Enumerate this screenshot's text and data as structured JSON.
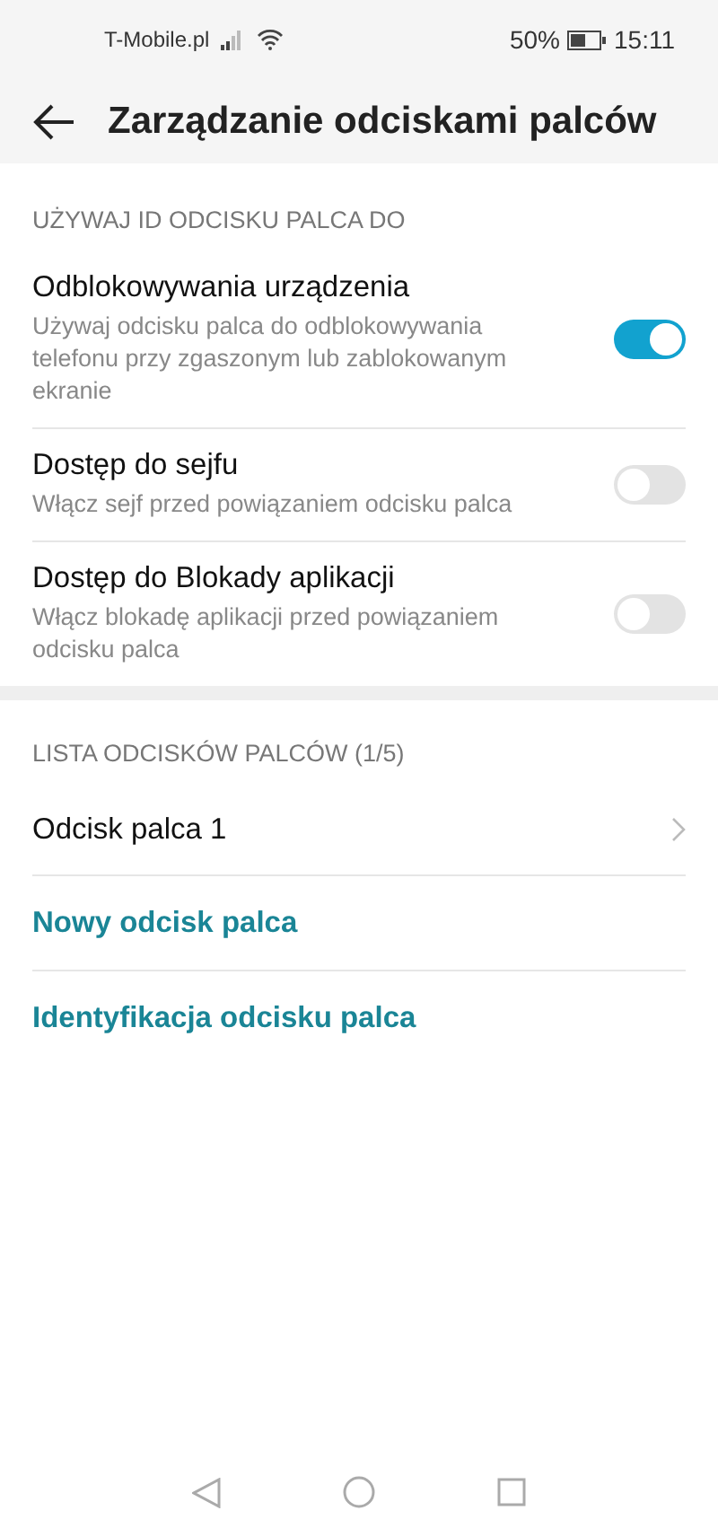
{
  "status_bar": {
    "carrier": "T-Mobile.pl",
    "battery": "50%",
    "time": "15:11"
  },
  "header": {
    "title": "Zarządzanie odciskami palców"
  },
  "sections": [
    {
      "title": "UŻYWAJ ID ODCISKU PALCA DO",
      "items": [
        {
          "kind": "toggle",
          "title": "Odblokowywania urządzenia",
          "subtitle": "Używaj odcisku palca do odblokowywania telefonu przy zgaszonym lub zablokowanym ekranie",
          "on": true
        },
        {
          "kind": "toggle",
          "title": "Dostęp do sejfu",
          "subtitle": "Włącz sejf przed powiązaniem odcisku palca",
          "on": false
        },
        {
          "kind": "toggle",
          "title": "Dostęp do Blokady aplikacji",
          "subtitle": "Włącz blokadę aplikacji przed powiązaniem odcisku palca",
          "on": false
        }
      ]
    },
    {
      "title": "LISTA ODCISKÓW PALCÓW (1/5)",
      "items": [
        {
          "kind": "nav",
          "title": "Odcisk palca 1"
        },
        {
          "kind": "action",
          "title": "Nowy odcisk palca"
        },
        {
          "kind": "action",
          "title": "Identyfikacja odcisku palca"
        }
      ]
    }
  ]
}
